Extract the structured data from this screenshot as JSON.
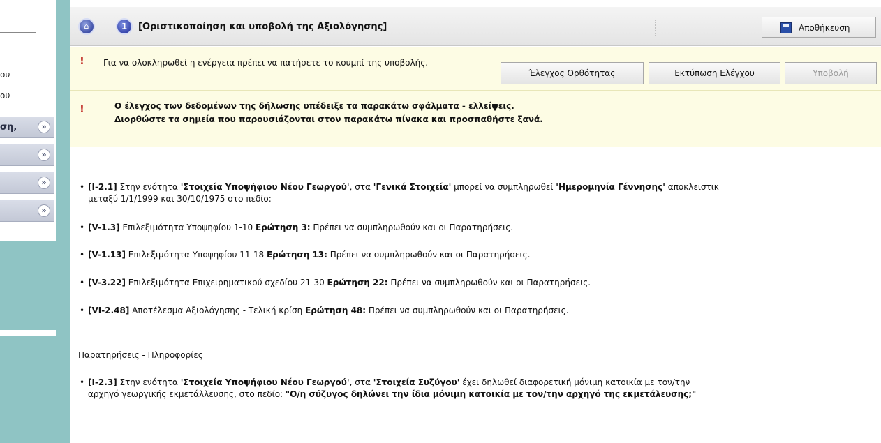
{
  "sidebar": {
    "fragments": [
      "ου",
      "ου"
    ],
    "bars": [
      {
        "label": "ση,"
      },
      {
        "label": ""
      },
      {
        "label": ""
      },
      {
        "label": ""
      }
    ]
  },
  "header": {
    "step_number": "1",
    "title": "[Οριστικοποίηση και υποβολή της Αξιολόγησης]",
    "save_label": "Αποθήκευση"
  },
  "actionbar": {
    "message": "Για να ολοκληρωθεί η ενέργεια πρέπει να πατήσετε το κουμπί της υποβολής.",
    "buttons": {
      "check": "Έλεγχος Ορθότητας",
      "print": "Εκτύπωση Ελέγχου",
      "submit": "Υποβολή"
    }
  },
  "error_box": {
    "line1": "Ο έλεγχος των δεδομένων της δήλωσης υπέδειξε τα παρακάτω σφάλματα - ελλείψεις.",
    "line2": "Διορθώστε τα σημεία που παρουσιάζονται στον παρακάτω πίνακα και προσπαθήστε ξανά."
  },
  "errors": [
    {
      "code": "[I-2.1]",
      "t1": " Στην ενότητα ",
      "b1": "'Στοιχεία Υποψήφιου Νέου Γεωργού'",
      "t2": ", στα ",
      "b2": "'Γενικά Στοιχεία'",
      "t3": " μπορεί να συμπληρωθεί ",
      "b3": "'Ημερομηνία Γέννησης'",
      "t4": " αποκλειστικ",
      "line2": "μεταξύ 1/1/1999 και 30/10/1975 στο πεδίο:"
    },
    {
      "code": "[V-1.3]",
      "pre": " Επιλεξιμότητα Υποψηφίου 1-10 ",
      "q": "Ερώτηση 3:",
      "post": " Πρέπει να συμπληρωθούν και οι Παρατηρήσεις."
    },
    {
      "code": "[V-1.13]",
      "pre": " Επιλεξιμότητα Υποψηφίου 11-18 ",
      "q": "Ερώτηση 13:",
      "post": " Πρέπει να συμπληρωθούν και οι Παρατηρήσεις."
    },
    {
      "code": "[V-3.22]",
      "pre": " Επιλεξιμότητα Επιχειρηματικού σχεδίου 21-30 ",
      "q": "Ερώτηση 22:",
      "post": " Πρέπει να συμπληρωθούν και οι Παρατηρήσεις."
    },
    {
      "code": "[VI-2.48]",
      "pre": " Αποτέλεσμα Αξιολόγησης - Τελική κρίση ",
      "q": "Ερώτηση 48:",
      "post": " Πρέπει να συμπληρωθούν και οι Παρατηρήσεις."
    }
  ],
  "info": {
    "heading": "Παρατηρήσεις - Πληροφορίες",
    "item": {
      "code": "[I-2.3]",
      "t1": " Στην ενότητα ",
      "b1": "'Στοιχεία Υποψήφιου Νέου Γεωργού'",
      "t2": ", στα ",
      "b2": "'Στοιχεία Συζύγου'",
      "t3": " έχει δηλωθεί διαφορετική μόνιμη κατοικία με τον/την",
      "line2": "αρχηγό γεωργικής εκμετάλλευσης, στο πεδίο: ",
      "b3": "\"Ο/η σύζυγος δηλώνει την ίδια μόνιμη κατοικία με τον/την αρχηγό της εκμετάλευσης;\""
    }
  }
}
